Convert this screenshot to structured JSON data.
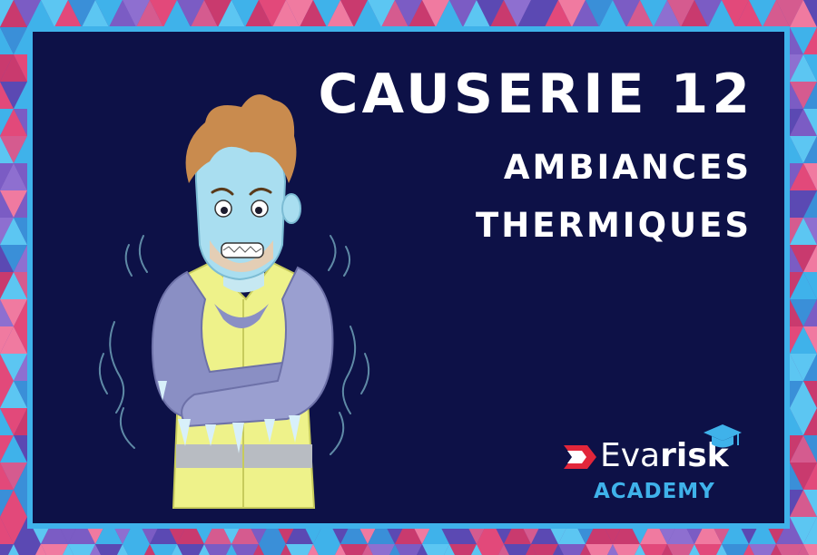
{
  "title": "CAUSERIE 12",
  "subtitle_line1": "AMBIANCES",
  "subtitle_line2": "THERMIQUES",
  "logo": {
    "brand_eva": "Eva",
    "brand_risk": "risk",
    "academy": "ACADEMY"
  },
  "icons": [
    "evarisk-flag-icon",
    "graduation-cap-icon"
  ],
  "colors": {
    "background": "#0d1147",
    "frame_border": "#3fb2ea",
    "title_text": "#ffffff",
    "academy_text": "#3fb2ea",
    "logo_red": "#e2263a",
    "vest": "#eef28a",
    "frozen_skin": "#a9def0",
    "hair": "#c98b4e",
    "sleeves": "#8a8fc4"
  }
}
